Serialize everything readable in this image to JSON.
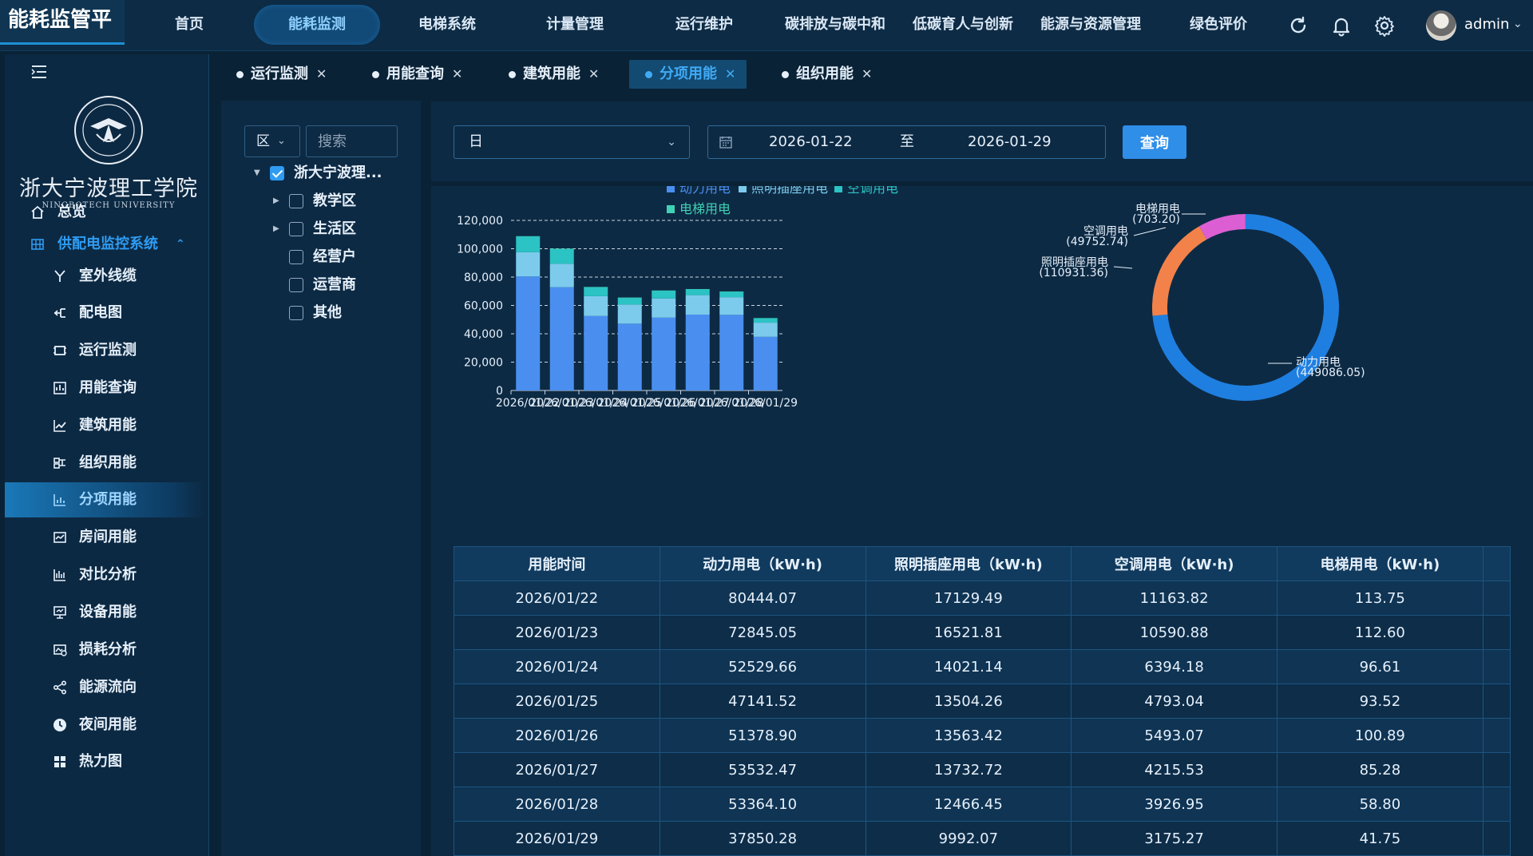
{
  "app": {
    "title": "能耗监管平"
  },
  "topnav": {
    "items": [
      "首页",
      "能耗监测",
      "电梯系统",
      "计量管理",
      "运行维护",
      "碳排放与碳中和",
      "低碳育人与创新",
      "能源与资源管理",
      "绿色评价"
    ],
    "active_index": 1,
    "icons": [
      "refresh-icon",
      "bell-icon",
      "gear-icon"
    ],
    "username": "admin"
  },
  "sidebar": {
    "school_name": "浙大宁波理工学院",
    "school_name_en": "NINGBOTECH UNIVERSITY",
    "items": [
      {
        "label": "总览",
        "level": 1,
        "icon": "home-icon"
      },
      {
        "label": "供配电监控系统",
        "level": 1,
        "icon": "grid-icon",
        "group": true
      },
      {
        "label": "室外线缆",
        "level": 2,
        "icon": "cable-icon"
      },
      {
        "label": "配电图",
        "level": 2,
        "icon": "distribution-icon"
      },
      {
        "label": "运行监测",
        "level": 2,
        "icon": "monitor-icon"
      },
      {
        "label": "用能查询",
        "level": 2,
        "icon": "query-icon"
      },
      {
        "label": "建筑用能",
        "level": 2,
        "icon": "line-chart-icon"
      },
      {
        "label": "组织用能",
        "level": 2,
        "icon": "org-icon"
      },
      {
        "label": "分项用能",
        "level": 2,
        "icon": "bar-chart-icon",
        "active": true
      },
      {
        "label": "房间用能",
        "level": 2,
        "icon": "room-icon"
      },
      {
        "label": "对比分析",
        "level": 2,
        "icon": "compare-icon"
      },
      {
        "label": "设备用能",
        "level": 2,
        "icon": "device-icon"
      },
      {
        "label": "损耗分析",
        "level": 2,
        "icon": "loss-icon"
      },
      {
        "label": "能源流向",
        "level": 2,
        "icon": "share-icon"
      },
      {
        "label": "夜间用能",
        "level": 2,
        "icon": "clock-icon"
      },
      {
        "label": "热力图",
        "level": 2,
        "icon": "heatmap-icon"
      }
    ]
  },
  "tabs": [
    {
      "label": "运行监测"
    },
    {
      "label": "用能查询"
    },
    {
      "label": "建筑用能"
    },
    {
      "label": "分项用能",
      "active": true
    },
    {
      "label": "组织用能"
    }
  ],
  "tree": {
    "area_select": "区",
    "search_placeholder": "搜索",
    "root": {
      "label": "浙大宁波理...",
      "checked": true
    },
    "children": [
      {
        "label": "教学区",
        "expandable": true
      },
      {
        "label": "生活区",
        "expandable": true
      },
      {
        "label": "经营户",
        "expandable": false
      },
      {
        "label": "运营商",
        "expandable": false
      },
      {
        "label": "其他",
        "expandable": false
      }
    ]
  },
  "filters": {
    "period": "日",
    "start_date": "2026-01-22",
    "to_label": "至",
    "end_date": "2026-01-29",
    "query_label": "查询"
  },
  "colors": {
    "power": "#4a8ff0",
    "lighting": "#7ccbec",
    "ac": "#2bc3c3",
    "elevator": "#3fd1b4",
    "donut_power": "#1f7fe0",
    "donut_lighting": "#f2824a",
    "donut_ac": "#db5fd3",
    "accent": "#2f9cf2"
  },
  "chart_data": [
    {
      "type": "bar",
      "stacked": true,
      "categories": [
        "2026/01/22",
        "2026/01/23",
        "2026/01/24",
        "2026/01/25",
        "2026/01/26",
        "2026/01/27",
        "2026/01/28",
        "2026/01/29"
      ],
      "series": [
        {
          "name": "动力用电",
          "values": [
            80444.07,
            72845.05,
            52529.66,
            47141.52,
            51378.9,
            53532.47,
            53364.1,
            37850.28
          ]
        },
        {
          "name": "照明插座用电",
          "values": [
            17129.49,
            16521.81,
            14021.14,
            13504.26,
            13563.42,
            13732.72,
            12466.45,
            9992.07
          ]
        },
        {
          "name": "空调用电",
          "values": [
            11163.82,
            10590.88,
            6394.18,
            4793.04,
            5493.07,
            4215.53,
            3926.95,
            3175.27
          ]
        },
        {
          "name": "电梯用电",
          "values": [
            113.75,
            112.6,
            96.61,
            93.52,
            100.89,
            85.28,
            58.8,
            41.75
          ]
        }
      ],
      "ylim": [
        0,
        120000
      ],
      "yticks": [
        "0",
        "20,000",
        "40,000",
        "60,000",
        "80,000",
        "100,000",
        "120,000"
      ],
      "grid": true,
      "legend": "top"
    },
    {
      "type": "pie",
      "donut": true,
      "slices": [
        {
          "name": "动力用电",
          "value": 449086.05,
          "label": "(449086.05)"
        },
        {
          "name": "照明插座用电",
          "value": 110931.36,
          "label": "(110931.36)"
        },
        {
          "name": "空调用电",
          "value": 49752.74,
          "label": "(49752.74)"
        },
        {
          "name": "电梯用电",
          "value": 703.2,
          "label": "(703.20)"
        }
      ]
    }
  ],
  "table": {
    "headers": [
      "用能时间",
      "动力用电（kW·h)",
      "照明插座用电（kW·h)",
      "空调用电（kW·h)",
      "电梯用电（kW·h)"
    ],
    "rows": [
      [
        "2026/01/22",
        "80444.07",
        "17129.49",
        "11163.82",
        "113.75"
      ],
      [
        "2026/01/23",
        "72845.05",
        "16521.81",
        "10590.88",
        "112.60"
      ],
      [
        "2026/01/24",
        "52529.66",
        "14021.14",
        "6394.18",
        "96.61"
      ],
      [
        "2026/01/25",
        "47141.52",
        "13504.26",
        "4793.04",
        "93.52"
      ],
      [
        "2026/01/26",
        "51378.90",
        "13563.42",
        "5493.07",
        "100.89"
      ],
      [
        "2026/01/27",
        "53532.47",
        "13732.72",
        "4215.53",
        "85.28"
      ],
      [
        "2026/01/28",
        "53364.10",
        "12466.45",
        "3926.95",
        "58.80"
      ],
      [
        "2026/01/29",
        "37850.28",
        "9992.07",
        "3175.27",
        "41.75"
      ]
    ]
  }
}
